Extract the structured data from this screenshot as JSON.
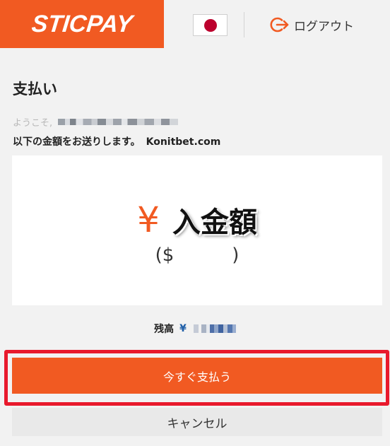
{
  "header": {
    "logo_text": "STICPAY",
    "flag_icon": "japan-flag-icon",
    "logout_label": "ログアウト",
    "logout_icon": "logout-arrow-icon",
    "accent_color": "#f15a22"
  },
  "page": {
    "title": "支払い",
    "welcome_text": "ようこそ,",
    "send_text": "以下の金額をお送りします。",
    "merchant": "Konitbet.com"
  },
  "amount": {
    "currency_symbol": "¥",
    "placeholder": "入金額",
    "usd_open": "($",
    "usd_close": ")"
  },
  "balance": {
    "label": "残高",
    "currency_symbol": "¥"
  },
  "actions": {
    "pay_label": "今すぐ支払う",
    "cancel_label": "キャンセル",
    "highlight_color": "#e8192c"
  }
}
